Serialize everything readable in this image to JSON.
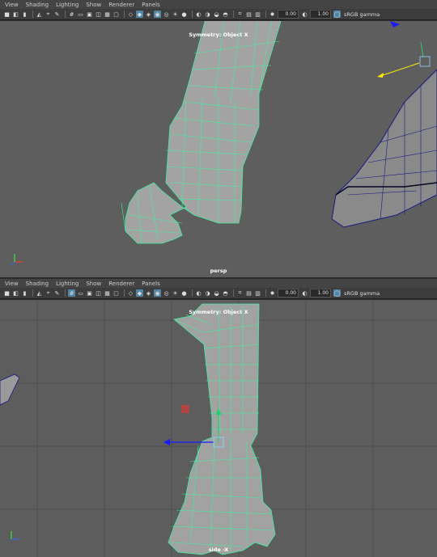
{
  "menu": [
    "View",
    "Shading",
    "Lighting",
    "Show",
    "Renderer",
    "Panels"
  ],
  "toolbar": {
    "exposure": "0.00",
    "gamma": "1.00",
    "color_space": "sRGB gamma"
  },
  "viewports": [
    {
      "symmetry_label": "Symmetry: Object X",
      "camera_label": "persp"
    },
    {
      "symmetry_label": "Symmetry: Object X",
      "camera_label": "side -X"
    }
  ],
  "colors": {
    "viewport_bg": "#5e5e5e",
    "wireframe_selected": "#3ff0a0",
    "wireframe_other": "#1a1a80",
    "mesh_fill": "#a8a8a8",
    "grid_line": "#4a4a4a",
    "toolbar_active": "#5285a6"
  },
  "icons": [
    "camera-icon",
    "grid-icon",
    "wireframe-icon",
    "smooth-shade-icon",
    "xray-icon",
    "light-icon",
    "isolate-icon",
    "color-management-icon"
  ]
}
